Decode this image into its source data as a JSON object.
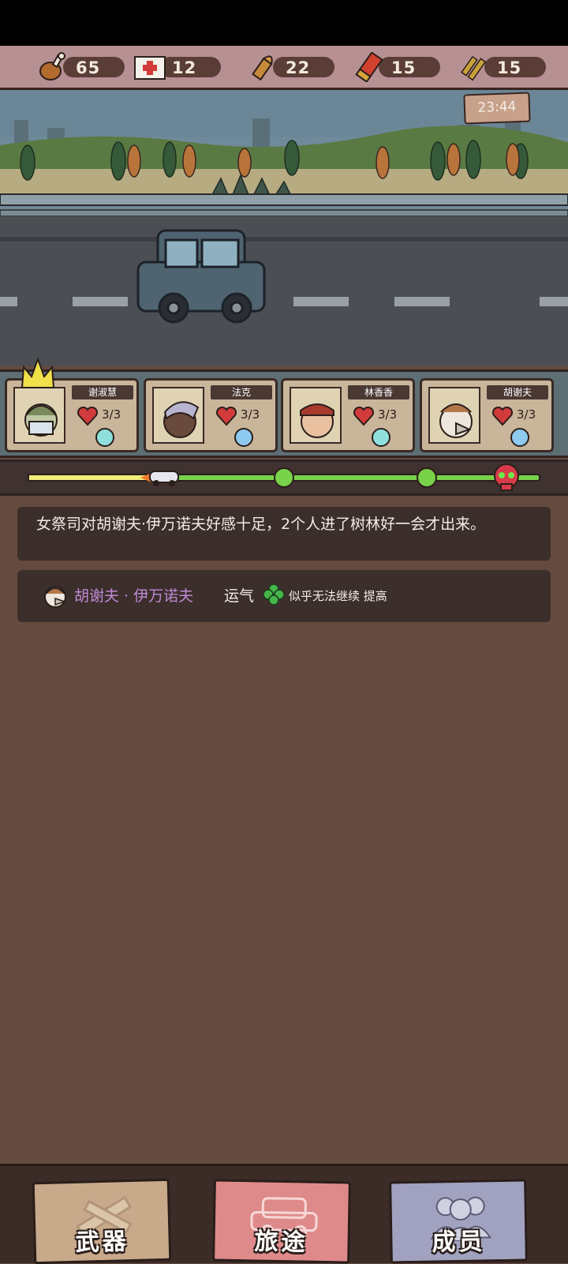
{
  "resources": [
    {
      "icon": "drumstick-icon",
      "value": "65"
    },
    {
      "icon": "medkit-icon",
      "value": "12"
    },
    {
      "icon": "bullet-icon",
      "value": "22"
    },
    {
      "icon": "shotgun-shell-icon",
      "value": "15"
    },
    {
      "icon": "rifle-ammo-icon",
      "value": "15"
    }
  ],
  "clock": "23:44",
  "crew": [
    {
      "name": "谢淑慧",
      "hp": "3/3",
      "mood": "neutral",
      "leader": true
    },
    {
      "name": "法克",
      "hp": "3/3",
      "mood": "sad",
      "leader": false
    },
    {
      "name": "林香香",
      "hp": "3/3",
      "mood": "neutral",
      "leader": false
    },
    {
      "name": "胡谢夫",
      "hp": "3/3",
      "mood": "sad",
      "leader": false
    }
  ],
  "journey": {
    "progress": 0.26,
    "checkpoints": [
      0.5,
      0.78
    ],
    "end": "skull-icon"
  },
  "log": {
    "message1": "女祭司对胡谢夫·伊万诺夫好感十足，2个人进了树林好一会才出来。",
    "name": "胡谢夫 · 伊万诺夫",
    "stat": "运气",
    "note": "似乎无法继续 提高"
  },
  "nav": {
    "weapons": "武器",
    "journey": "旅途",
    "members": "成员"
  },
  "colors": {
    "name_purple": "#c08ad6",
    "clover_green": "#45b54a",
    "progress_yellow": "#f2ec78",
    "progress_green": "#79d34a",
    "skull_red": "#d83a4a"
  }
}
